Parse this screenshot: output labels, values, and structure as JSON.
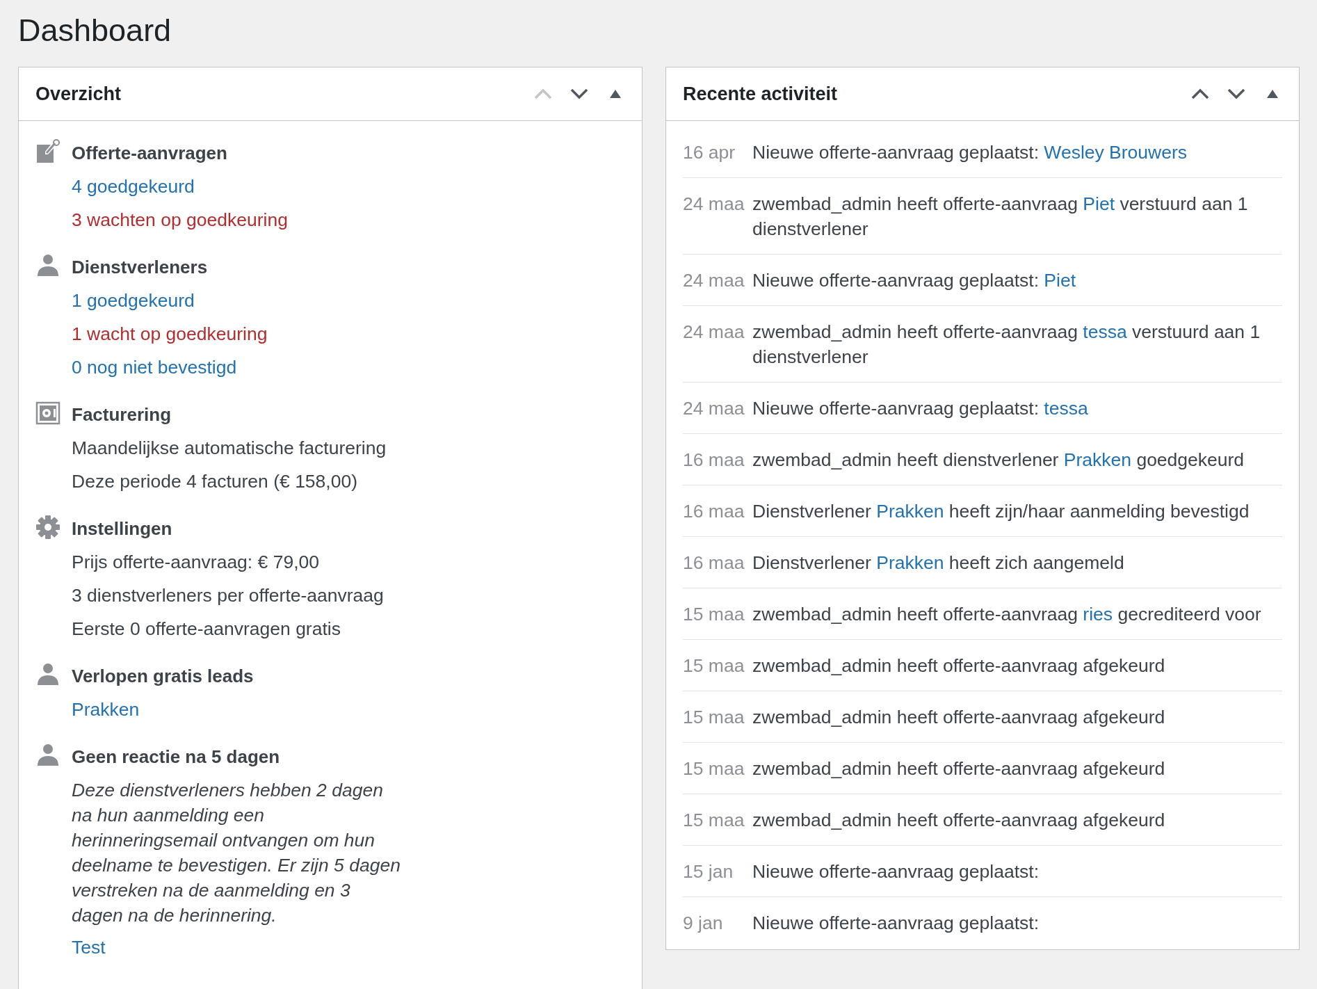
{
  "page_title": "Dashboard",
  "overview": {
    "title": "Overzicht",
    "controls": {
      "move_up_disabled": true,
      "move_down_disabled": false
    },
    "sections": [
      {
        "kind": "quote",
        "title": "Offerte-aanvragen",
        "lines": [
          {
            "kind": "link",
            "text": "4 goedgekeurd"
          },
          {
            "kind": "alert",
            "text": "3 wachten op goedkeuring"
          }
        ]
      },
      {
        "kind": "person",
        "title": "Dienstverleners",
        "lines": [
          {
            "kind": "link",
            "text": "1 goedgekeurd"
          },
          {
            "kind": "alert",
            "text": "1 wacht op goedkeuring"
          },
          {
            "kind": "link",
            "text": "0 nog niet bevestigd"
          }
        ]
      },
      {
        "kind": "billing",
        "title": "Facturering",
        "lines": [
          {
            "kind": "text",
            "text": "Maandelijkse automatische facturering"
          },
          {
            "kind": "text",
            "text": "Deze periode 4 facturen (€ 158,00)"
          }
        ]
      },
      {
        "kind": "gear",
        "title": "Instellingen",
        "lines": [
          {
            "kind": "text",
            "text": "Prijs offerte-aanvraag: € 79,00"
          },
          {
            "kind": "text",
            "text": "3 dienstverleners per offerte-aanvraag"
          },
          {
            "kind": "text",
            "text": "Eerste 0 offerte-aanvragen gratis"
          }
        ]
      },
      {
        "kind": "person",
        "title": "Verlopen gratis leads",
        "lines": [
          {
            "kind": "link",
            "text": "Prakken"
          }
        ]
      },
      {
        "kind": "person",
        "title": "Geen reactie na 5 dagen",
        "lines": [
          {
            "kind": "note",
            "text": "Deze dienstverleners hebben 2 dagen na hun aanmelding een herinneringsemail ontvangen om hun deelname te bevestigen. Er zijn 5 dagen verstreken na de aanmelding en 3 dagen na de herinnering."
          },
          {
            "kind": "link",
            "text": "Test"
          }
        ]
      }
    ]
  },
  "activity": {
    "title": "Recente activiteit",
    "controls": {
      "move_up_disabled": false,
      "move_down_disabled": false
    },
    "items": [
      {
        "date": "16 apr",
        "parts": [
          {
            "kind": "text",
            "text": "Nieuwe offerte-aanvraag geplaatst: "
          },
          {
            "kind": "link",
            "text": "Wesley Brouwers"
          }
        ]
      },
      {
        "date": "24 maa",
        "parts": [
          {
            "kind": "text",
            "text": "zwembad_admin heeft offerte-aanvraag "
          },
          {
            "kind": "link",
            "text": "Piet"
          },
          {
            "kind": "text",
            "text": " verstuurd aan 1 dienstverlener"
          }
        ]
      },
      {
        "date": "24 maa",
        "parts": [
          {
            "kind": "text",
            "text": "Nieuwe offerte-aanvraag geplaatst: "
          },
          {
            "kind": "link",
            "text": "Piet"
          }
        ]
      },
      {
        "date": "24 maa",
        "parts": [
          {
            "kind": "text",
            "text": "zwembad_admin heeft offerte-aanvraag "
          },
          {
            "kind": "link",
            "text": "tessa"
          },
          {
            "kind": "text",
            "text": " verstuurd aan 1 dienstverlener"
          }
        ]
      },
      {
        "date": "24 maa",
        "parts": [
          {
            "kind": "text",
            "text": "Nieuwe offerte-aanvraag geplaatst: "
          },
          {
            "kind": "link",
            "text": "tessa"
          }
        ]
      },
      {
        "date": "16 maa",
        "parts": [
          {
            "kind": "text",
            "text": "zwembad_admin heeft dienstverlener "
          },
          {
            "kind": "link",
            "text": "Prakken"
          },
          {
            "kind": "text",
            "text": " goedgekeurd"
          }
        ]
      },
      {
        "date": "16 maa",
        "parts": [
          {
            "kind": "text",
            "text": "Dienstverlener "
          },
          {
            "kind": "link",
            "text": "Prakken"
          },
          {
            "kind": "text",
            "text": " heeft zijn/haar aanmelding bevestigd"
          }
        ]
      },
      {
        "date": "16 maa",
        "parts": [
          {
            "kind": "text",
            "text": "Dienstverlener "
          },
          {
            "kind": "link",
            "text": "Prakken"
          },
          {
            "kind": "text",
            "text": " heeft zich aangemeld"
          }
        ]
      },
      {
        "date": "15 maa",
        "parts": [
          {
            "kind": "text",
            "text": "zwembad_admin heeft offerte-aanvraag "
          },
          {
            "kind": "link",
            "text": "ries"
          },
          {
            "kind": "text",
            "text": " gecrediteerd voor"
          }
        ]
      },
      {
        "date": "15 maa",
        "parts": [
          {
            "kind": "text",
            "text": "zwembad_admin heeft offerte-aanvraag afgekeurd"
          }
        ]
      },
      {
        "date": "15 maa",
        "parts": [
          {
            "kind": "text",
            "text": "zwembad_admin heeft offerte-aanvraag afgekeurd"
          }
        ]
      },
      {
        "date": "15 maa",
        "parts": [
          {
            "kind": "text",
            "text": "zwembad_admin heeft offerte-aanvraag afgekeurd"
          }
        ]
      },
      {
        "date": "15 maa",
        "parts": [
          {
            "kind": "text",
            "text": "zwembad_admin heeft offerte-aanvraag afgekeurd"
          }
        ]
      },
      {
        "date": "15 jan",
        "parts": [
          {
            "kind": "text",
            "text": "Nieuwe offerte-aanvraag geplaatst:"
          }
        ]
      },
      {
        "date": "9 jan",
        "parts": [
          {
            "kind": "text",
            "text": "Nieuwe offerte-aanvraag geplaatst:"
          }
        ]
      }
    ]
  }
}
